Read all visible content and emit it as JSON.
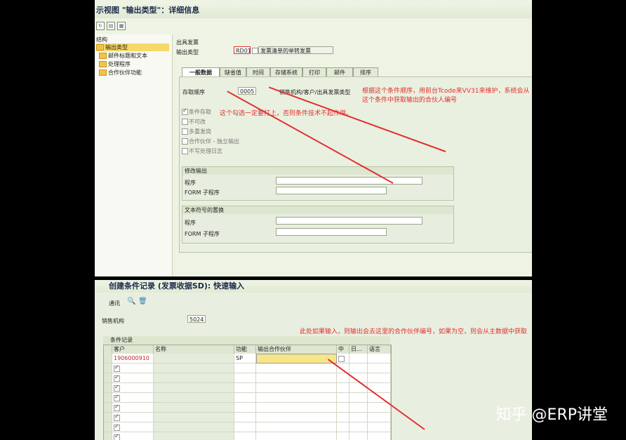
{
  "top": {
    "title": "示视图 \"输出类型\"：详细信息",
    "tree": {
      "header": "结构",
      "items": [
        "输出类型",
        "邮件标题和文本",
        "处理程序",
        "合作伙伴功能"
      ]
    },
    "output_section_label": "出具发票",
    "output_type_label": "输出类型",
    "output_type_code": "RD01",
    "output_type_desc": "发票清单的举转发票",
    "tabs": [
      "一般数据",
      "缺省值",
      "时间",
      "存储系统",
      "打印",
      "邮件",
      "排序"
    ],
    "access_seq_label": "存取顺序",
    "access_seq_value": "0005",
    "access_seq_desc": "销售机构/客户/出具发票类型",
    "checkboxes": [
      {
        "label": "条件存取",
        "checked": true
      },
      {
        "label": "不可改",
        "checked": false
      },
      {
        "label": "多重发岗",
        "checked": false
      },
      {
        "label": "合作伙伴 - 独立输出",
        "checked": false
      },
      {
        "label": "不写处理日志",
        "checked": false
      }
    ],
    "group1_title": "修改输出",
    "group2_title": "文本符号的置换",
    "program_label": "程序",
    "form_label": "FORM 子程序",
    "annotation1": "根据这个条件顺序，用前台Tcode来VV31来维护，系统会从这个条件中获取输出的合伙人编号",
    "annotation2": "这个勾选一定要打上，否则条件技术不起作用。"
  },
  "bottom": {
    "title": "创建条件记录 (发票收据SD): 快速输入",
    "toolbar_label": "通讯",
    "sales_org_label": "销售机构",
    "sales_org_value": "5024",
    "section_title": "条件记录",
    "columns": [
      "客户",
      "名称",
      "功能",
      "输出合作伙伴",
      "中",
      "日...",
      "语言"
    ],
    "row1": {
      "customer": "1906000910",
      "function": "SP"
    },
    "annotation": "此处如果输入，则输出会去这里的合作伙伴编号，如果为空，则会从主数据中获取"
  },
  "watermark": "知乎 @ERP讲堂",
  "colors": {
    "annotation": "#e03030",
    "accent": "#1c2a4a"
  }
}
